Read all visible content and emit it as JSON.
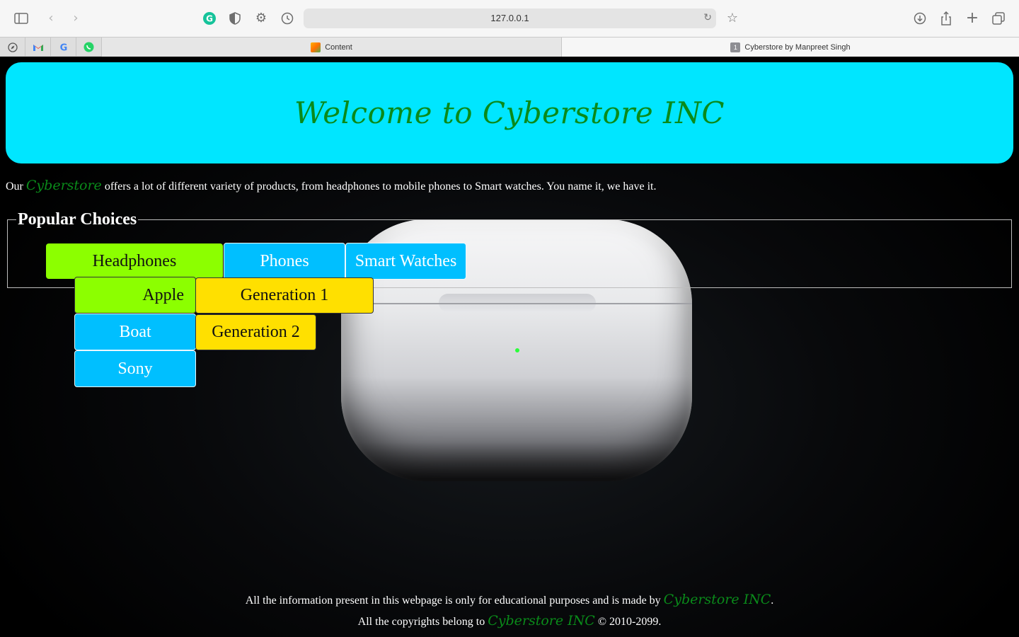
{
  "browser": {
    "url": "127.0.0.1",
    "tabs": [
      {
        "label": "Content",
        "active": false
      },
      {
        "label": "Cyberstore by Manpreet Singh",
        "active": true,
        "badge": "1"
      }
    ],
    "favorites": [
      "compass-icon",
      "gmail-icon",
      "google-icon",
      "whatsapp-icon"
    ]
  },
  "header": {
    "title": "Welcome to Cyberstore INC"
  },
  "intro": {
    "prefix": "Our",
    "brand": "Cyberstore",
    "text": "offers a lot of different variety of products, from headphones to mobile phones to Smart watches. You name it, we have it."
  },
  "choices": {
    "legend": "Popular Choices",
    "categories": [
      "Headphones",
      "Phones",
      "Smart Watches"
    ],
    "brands": [
      "Apple",
      "Boat",
      "Sony"
    ],
    "generations": [
      "Generation 1",
      "Generation 2"
    ]
  },
  "footer": {
    "line1_prefix": "All the information present in this webpage is only for educational purposes and is made by",
    "line1_brand": "Cyberstore INC",
    "line1_suffix": ".",
    "line2_prefix": "All the copyrights belong to",
    "line2_brand": "Cyberstore INC",
    "line2_suffix": "© 2010-2099."
  },
  "colors": {
    "header_bg": "#00e6ff",
    "brand_text": "#0a8a1a",
    "green_button": "#8cff00",
    "blue_button": "#00bfff",
    "yellow_button": "#ffe000"
  }
}
